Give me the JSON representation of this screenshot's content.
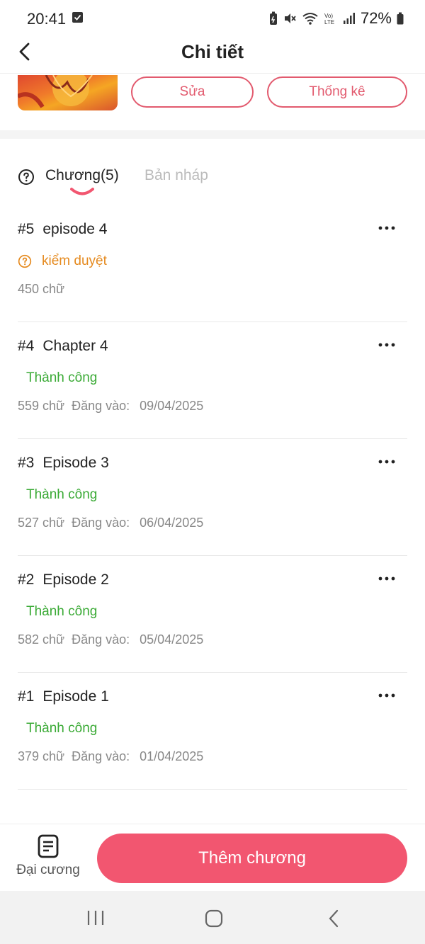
{
  "status_bar": {
    "time": "20:41",
    "battery": "72%",
    "icons": [
      "checkbox-icon",
      "battery-saver-icon",
      "mute-icon",
      "wifi-icon",
      "volte-icon",
      "signal-icon",
      "battery-icon"
    ]
  },
  "header": {
    "title": "Chi tiết"
  },
  "actions": {
    "edit_label": "Sửa",
    "stats_label": "Thống kê"
  },
  "tabs": {
    "chapters_label": "Chương(5)",
    "drafts_label": "Bản nháp"
  },
  "chapters": [
    {
      "number": "#5",
      "title": "episode 4",
      "status": "kiểm duyệt",
      "status_type": "pending",
      "words": "450 chữ",
      "published_label": "",
      "date": ""
    },
    {
      "number": "#4",
      "title": "Chapter 4",
      "status": "Thành công",
      "status_type": "success",
      "words": "559 chữ",
      "published_label": "Đăng vào:",
      "date": "09/04/2025"
    },
    {
      "number": "#3",
      "title": "Episode 3",
      "status": "Thành công",
      "status_type": "success",
      "words": "527 chữ",
      "published_label": "Đăng vào:",
      "date": "06/04/2025"
    },
    {
      "number": "#2",
      "title": "Episode 2",
      "status": "Thành công",
      "status_type": "success",
      "words": "582 chữ",
      "published_label": "Đăng vào:",
      "date": "05/04/2025"
    },
    {
      "number": "#1",
      "title": "Episode 1",
      "status": "Thành công",
      "status_type": "success",
      "words": "379 chữ",
      "published_label": "Đăng vào:",
      "date": "01/04/2025"
    }
  ],
  "bottom": {
    "outline_label": "Đại cương",
    "add_chapter_label": "Thêm chương"
  },
  "colors": {
    "accent": "#f25670",
    "pending": "#e58a1f",
    "success": "#3aaa35"
  }
}
